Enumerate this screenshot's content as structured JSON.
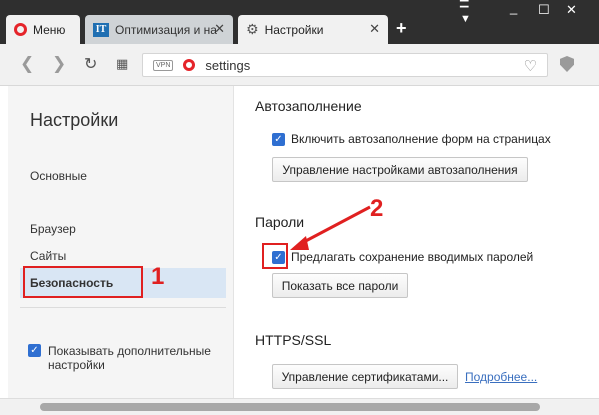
{
  "tabs": [
    {
      "label": "Меню",
      "icon": "opera-logo-icon"
    },
    {
      "label": "Оптимизация и на",
      "icon": "it-site-icon"
    },
    {
      "label": "Настройки",
      "icon": "gear-icon"
    }
  ],
  "addressbar": {
    "vpn_badge": "VPN",
    "url": "settings"
  },
  "sidebar": {
    "title": "Настройки",
    "items": [
      {
        "label": "Основные"
      },
      {
        "label": "Браузер"
      },
      {
        "label": "Сайты"
      },
      {
        "label": "Безопасность",
        "selected": true
      }
    ],
    "advanced_checkbox_label": "Показывать дополнительные настройки",
    "callout_number": "1"
  },
  "autofill": {
    "title": "Автозаполнение",
    "checkbox_label": "Включить автозаполнение форм на страницах",
    "button_label": "Управление настройками автозаполнения"
  },
  "passwords": {
    "title": "Пароли",
    "checkbox_label": "Предлагать сохранение вводимых паролей",
    "button_label": "Показать все пароли",
    "callout_number": "2"
  },
  "https": {
    "title": "HTTPS/SSL",
    "button_label": "Управление сертификатами...",
    "link_label": "Подробнее..."
  },
  "colors": {
    "accent": "#2f6fd1",
    "annotation": "#e02020",
    "opera_red": "#e5242a"
  }
}
